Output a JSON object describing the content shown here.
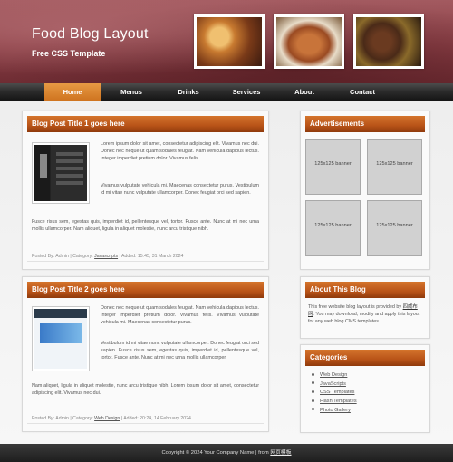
{
  "header": {
    "title": "Food Blog Layout",
    "subtitle": "Free CSS Template"
  },
  "nav": {
    "items": [
      "Home",
      "Menus",
      "Drinks",
      "Services",
      "About",
      "Contact"
    ],
    "active_index": 0
  },
  "posts": [
    {
      "title": "Blog Post Title 1 goes here",
      "para1": "Lorem ipsum dolor sit amet, consectetur adipiscing elit. Vivamus nec dui. Donec nec neque ut quam sodales feugiat. Nam vehicula dapibus lectus. Integer imperdiet pretium dolor. Vivamus felis.",
      "para2": "Vivamus vulputate vehicula mi. Maecenas consectetur purus. Vestibulum id mi vitae nunc vulputate ullamcorper. Donec feugiat orci sed sapien.",
      "para3": "Fusce risus sem, egestas quis, imperdiet id, pellentesque vel, tortor. Fusce ante. Nunc at mi nec urna mollis ullamcorper. Nam aliquet, ligula in aliquet molestie, nunc arcu tristique nibh.",
      "meta_prefix": "Posted By: Admin | Category: ",
      "category": "Javascripts",
      "meta_suffix": " | Added: 15:45, 31 March 2024"
    },
    {
      "title": "Blog Post Title 2 goes here",
      "para1": "Donec nec neque ut quam sodales feugiat. Nam vehicula dapibus lectus. Integer imperdiet pretium dolor. Vivamus felis. Vivamus vulputate vehicula mi. Maecenas consectetur purus.",
      "para2": "Vestibulum id mi vitae nunc vulputate ullamcorper. Donec feugiat orci sed sapien. Fusce risus sem, egestas quis, imperdiet id, pellentesque vel, tortor. Fusce ante. Nunc at mi nec urna mollis ullamcorper.",
      "para3": "Nam aliquet, ligula in aliquet molestie, nunc arcu tristique nibh. Lorem ipsum dolor sit amet, consectetur adipiscing elit. Vivamus nec dui.",
      "meta_prefix": "Posted By: Admin | Category: ",
      "category": "Web Design",
      "meta_suffix": " | Added: 20:24, 14 February 2024"
    }
  ],
  "sidebar": {
    "ads": {
      "title": "Advertisements",
      "banners": [
        "125x125 banner",
        "125x125 banner",
        "125x125 banner",
        "125x125 banner"
      ]
    },
    "about": {
      "title": "About This Blog",
      "text_before": "This free website blog layout is provided by ",
      "link": "四威布网",
      "text_after": ". You may download, modify and apply this layout for any web blog CMS templates."
    },
    "categories": {
      "title": "Categories",
      "items": [
        "Web Design",
        "JavaScripts",
        "CSS Templates",
        "Flash Templates",
        "Photo Gallery"
      ]
    }
  },
  "footer": {
    "text": "Copyright © 2024 Your Company Name | from ",
    "link": "网页模板"
  },
  "colors": {
    "header": "#8a3f46",
    "panel_head": "#b85318",
    "nav_active": "#e08a30",
    "nav_bg": "#2a2a2a"
  }
}
